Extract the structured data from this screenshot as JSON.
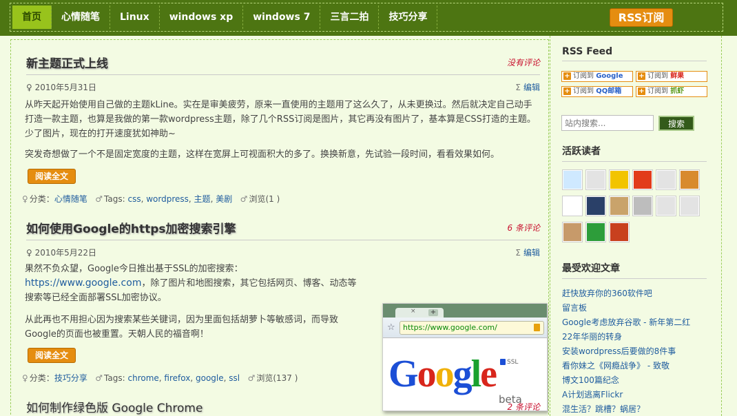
{
  "nav": {
    "items": [
      {
        "label": "首页"
      },
      {
        "label": "心情随笔"
      },
      {
        "label": "Linux"
      },
      {
        "label": "windows xp"
      },
      {
        "label": "windows 7"
      },
      {
        "label": "三言二拍"
      },
      {
        "label": "技巧分享"
      }
    ],
    "rss_label": "RSS订阅"
  },
  "posts": [
    {
      "title": "新主题正式上线",
      "comments": "没有评论",
      "date": "2010年5月31日",
      "edit": "编辑",
      "paragraphs": [
        "从昨天起开始使用自己做的主题kLine。实在是审美疲劳，原来一直使用的主题用了这么久了，从未更换过。然后就决定自己动手打造一款主题，也算是我做的第一款wordpress主题，除了几个RSS订阅是图片，其它再没有图片了，基本算是CSS打造的主题。少了图片，现在的打开速度犹如神助~",
        "突发奇想做了一个不是固定宽度的主题，这样在宽屏上可视面积大的多了。换换新意，先试验一段时间，看看效果如何。"
      ],
      "read_more": "阅读全文",
      "category_label": "分类：",
      "category": "心情随笔",
      "tags_label": "Tags:",
      "tags": [
        "css",
        "wordpress",
        "主题",
        "美剧"
      ],
      "views": "浏览(1 )"
    },
    {
      "title": "如何使用Google的https加密搜索引擎",
      "comments": "6 条评论",
      "date": "2010年5月22日",
      "edit": "编辑",
      "paragraphs_pre": "果然不负众望，Google今日推出基于SSL的加密搜索：",
      "link": "https://www.google.com",
      "paragraphs_post": "，除了图片和地图搜索，其它包括网页、博客、动态等搜索等已经全面部署SSL加密协议。",
      "paragraph2": "从此再也不用担心因为搜索某些关键词，因为里面包括胡萝卜等敏感词，而导致Google的页面也被重置。天朝人民的福音啊！",
      "read_more": "阅读全文",
      "category_label": "分类：",
      "category": "技巧分享",
      "tags_label": "Tags:",
      "tags": [
        "chrome",
        "firefox",
        "google",
        "ssl"
      ],
      "views": "浏览(137 )",
      "image": {
        "url_text": "https://www.google.com/",
        "logo": [
          "G",
          "o",
          "o",
          "g",
          "l",
          "e"
        ],
        "ssl": "SSL",
        "beta": "beta"
      }
    },
    {
      "title": "如何制作绿色版 Google Chrome",
      "comments": "2 条评论"
    }
  ],
  "sidebar": {
    "rss_title": "RSS Feed",
    "subscribe": [
      {
        "prefix": "订阅到",
        "service": "Google"
      },
      {
        "prefix": "订阅到",
        "service": "鲜果"
      },
      {
        "prefix": "订阅到",
        "service": "QQ邮箱"
      },
      {
        "prefix": "订阅到",
        "service": "抓虾"
      }
    ],
    "search_placeholder": "站内搜索...",
    "search_button": "搜索",
    "readers_title": "活跃读者",
    "avatars": [
      {
        "color": "#cfe9ff"
      },
      {
        "color": "#e3e3e3"
      },
      {
        "color": "#f2c400"
      },
      {
        "color": "#e23b1a"
      },
      {
        "color": "#e3e3e3"
      },
      {
        "color": "#d88a2e"
      },
      {
        "color": "#ffffff"
      },
      {
        "color": "#2a4068"
      },
      {
        "color": "#c9a36b"
      },
      {
        "color": "#bdbdbd"
      },
      {
        "color": "#e3e3e3"
      },
      {
        "color": "#e3e3e3"
      },
      {
        "color": "#c79a6a"
      },
      {
        "color": "#2d9d3a"
      },
      {
        "color": "#c8401e"
      }
    ],
    "popular_title": "最受欢迎文章",
    "popular": [
      "赶快放弃你的360软件吧",
      "留言板",
      "Google考虑放弃谷歌 - 新年第二红",
      "22年华丽的转身",
      "安装wordpress后要做的8件事",
      "看你妹之《网瘾战争》 - 致敬",
      "博文100篇纪念",
      "A计划逃离Flickr",
      "混生活？跳槽？蜗居？"
    ]
  }
}
